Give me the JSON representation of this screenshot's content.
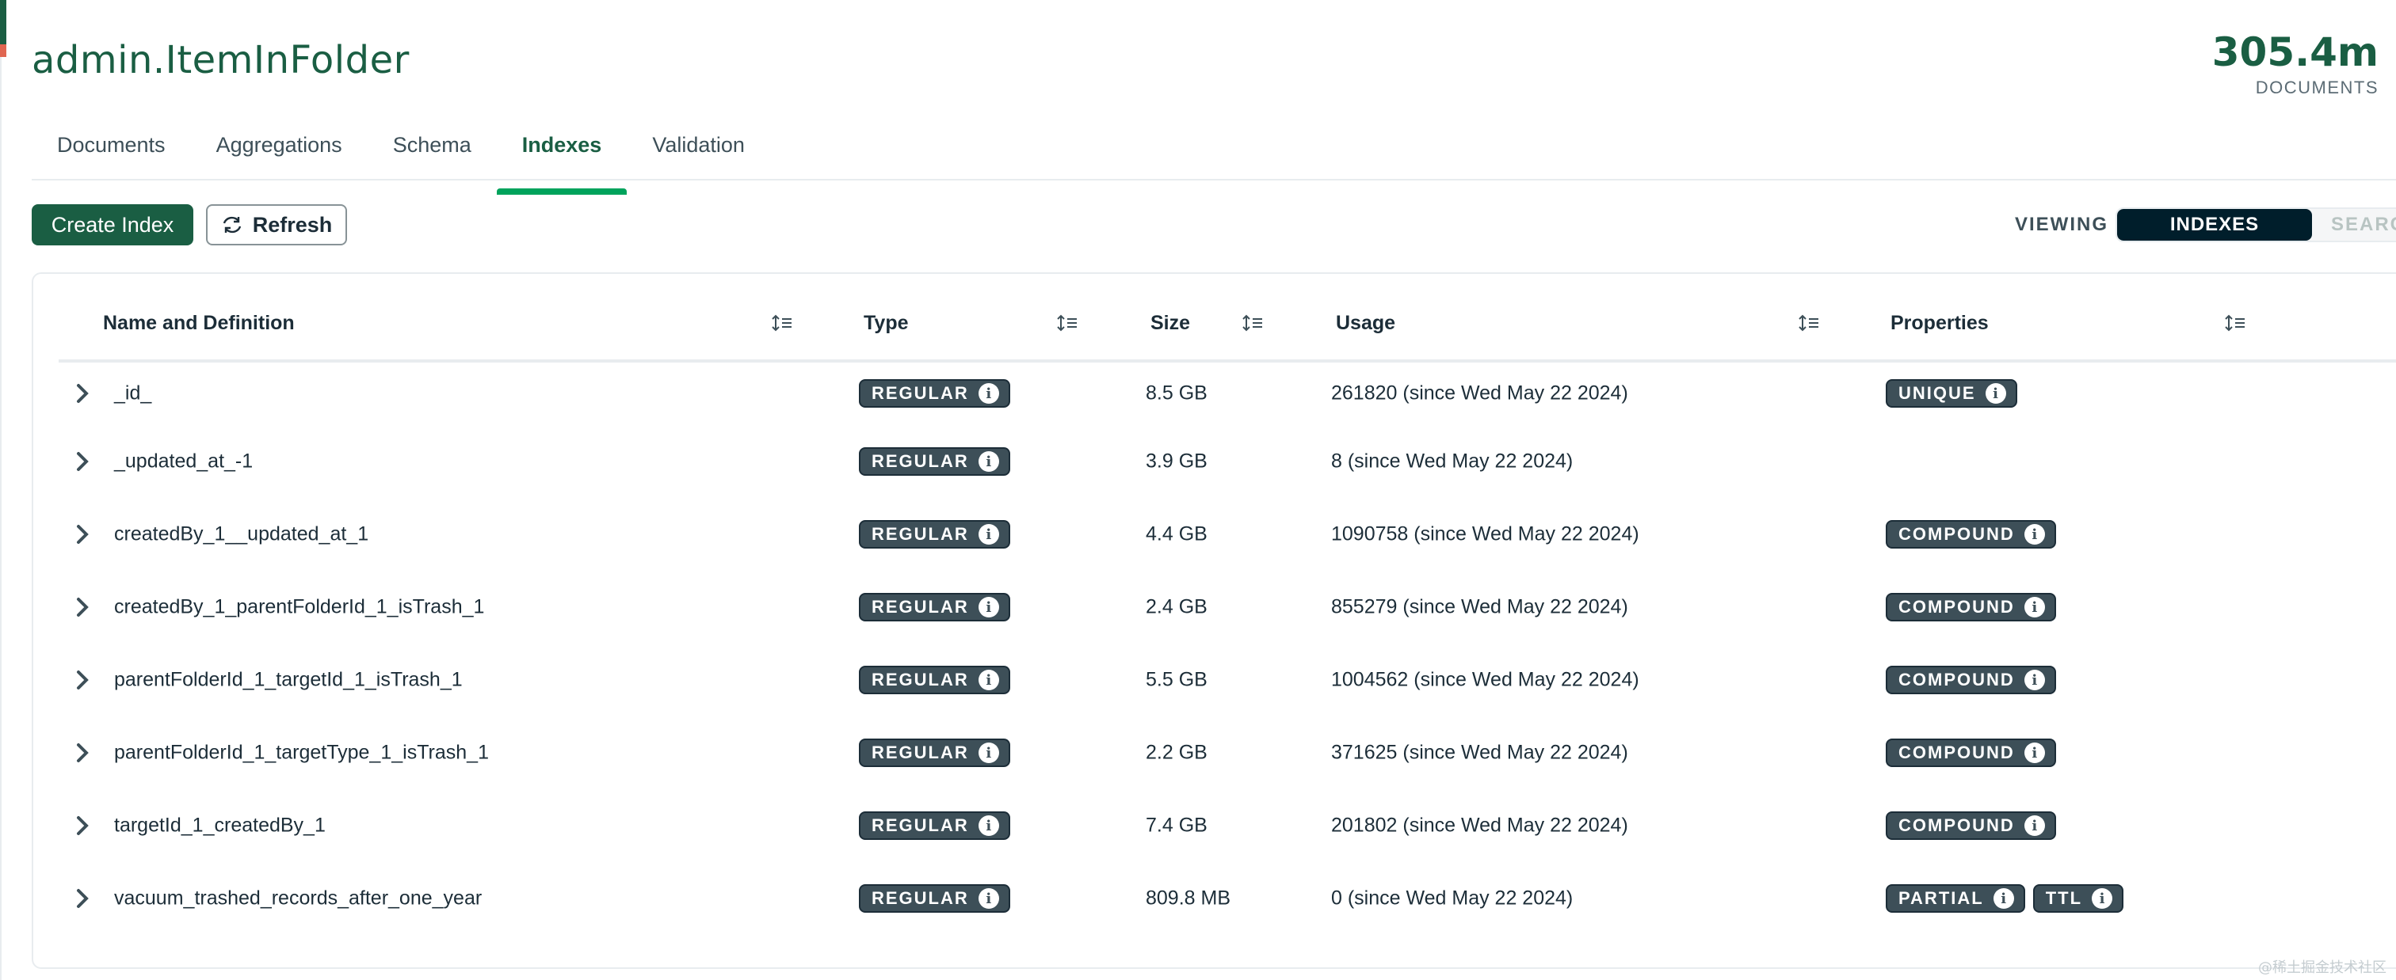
{
  "header": {
    "title": "admin.ItemInFolder",
    "doc_count": "305.4m",
    "doc_count_label": "DOCUMENTS"
  },
  "tabs": [
    {
      "label": "Documents",
      "active": false
    },
    {
      "label": "Aggregations",
      "active": false
    },
    {
      "label": "Schema",
      "active": false
    },
    {
      "label": "Indexes",
      "active": true
    },
    {
      "label": "Validation",
      "active": false
    }
  ],
  "toolbar": {
    "create_label": "Create Index",
    "refresh_label": "Refresh",
    "viewing_label": "VIEWING",
    "view_active": "INDEXES",
    "view_inactive": "SEARCH"
  },
  "table": {
    "columns": [
      "Name and Definition",
      "Type",
      "Size",
      "Usage",
      "Properties"
    ],
    "rows": [
      {
        "name": "_id_",
        "type": "REGULAR",
        "size": "8.5 GB",
        "usage": "261820 (since Wed May 22 2024)",
        "properties": [
          "UNIQUE"
        ]
      },
      {
        "name": "_updated_at_-1",
        "type": "REGULAR",
        "size": "3.9 GB",
        "usage": "8 (since Wed May 22 2024)",
        "properties": []
      },
      {
        "name": "createdBy_1__updated_at_1",
        "type": "REGULAR",
        "size": "4.4 GB",
        "usage": "1090758 (since Wed May 22 2024)",
        "properties": [
          "COMPOUND"
        ]
      },
      {
        "name": "createdBy_1_parentFolderId_1_isTrash_1",
        "type": "REGULAR",
        "size": "2.4 GB",
        "usage": "855279 (since Wed May 22 2024)",
        "properties": [
          "COMPOUND"
        ]
      },
      {
        "name": "parentFolderId_1_targetId_1_isTrash_1",
        "type": "REGULAR",
        "size": "5.5 GB",
        "usage": "1004562 (since Wed May 22 2024)",
        "properties": [
          "COMPOUND"
        ]
      },
      {
        "name": "parentFolderId_1_targetType_1_isTrash_1",
        "type": "REGULAR",
        "size": "2.2 GB",
        "usage": "371625 (since Wed May 22 2024)",
        "properties": [
          "COMPOUND"
        ]
      },
      {
        "name": "targetId_1_createdBy_1",
        "type": "REGULAR",
        "size": "7.4 GB",
        "usage": "201802 (since Wed May 22 2024)",
        "properties": [
          "COMPOUND"
        ]
      },
      {
        "name": "vacuum_trashed_records_after_one_year",
        "type": "REGULAR",
        "size": "809.8 MB",
        "usage": "0 (since Wed May 22 2024)",
        "properties": [
          "PARTIAL",
          "TTL"
        ]
      }
    ]
  },
  "watermark": "@稀土掘金技术社区",
  "colors": {
    "brand_green": "#1a5e43",
    "tab_underline": "#00a35c",
    "badge_bg": "#3d4f58",
    "segment_active_bg": "#001e2b"
  }
}
